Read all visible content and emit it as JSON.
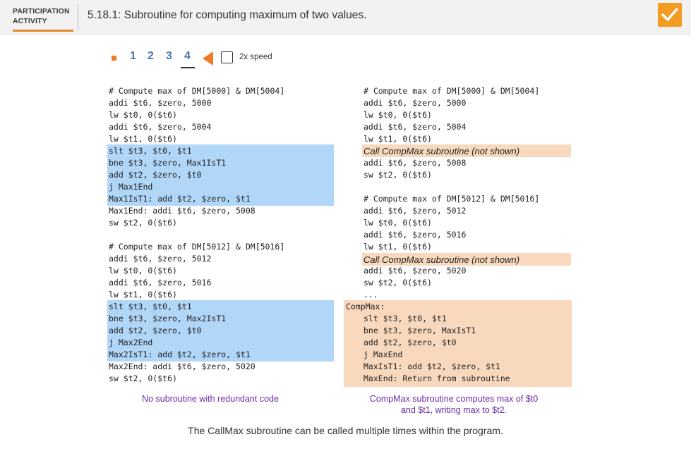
{
  "header": {
    "label_line1": "PARTICIPATION",
    "label_line2": "ACTIVITY",
    "title": "5.18.1: Subroutine for computing maximum of two values."
  },
  "controls": {
    "steps": [
      "1",
      "2",
      "3",
      "4"
    ],
    "current_step": "4",
    "speed_label": "2x speed"
  },
  "left_code": {
    "block1": [
      "# Compute max of DM[5000] & DM[5004]",
      "addi $t6, $zero, 5000",
      "lw $t0, 0($t6)",
      "addi $t6, $zero, 5004",
      "lw $t1, 0($t6)",
      "slt $t3, $t0, $t1",
      "bne $t3, $zero, Max1IsT1",
      "add $t2, $zero, $t0",
      "j Max1End",
      "Max1IsT1: add $t2, $zero, $t1",
      "Max1End: addi $t6, $zero, 5008",
      "sw $t2, 0($t6)"
    ],
    "block2": [
      "# Compute max of DM[5012] & DM[5016]",
      "addi $t6, $zero, 5012",
      "lw $t0, 0($t6)",
      "addi $t6, $zero, 5016",
      "lw $t1, 0($t6)",
      "slt $t3, $t0, $t1",
      "bne $t3, $zero, Max2IsT1",
      "add $t2, $zero, $t0",
      "j Max2End",
      "Max2IsT1: add $t2, $zero, $t1",
      "Max2End: addi $t6, $zero, 5020",
      "sw $t2, 0($t6)"
    ]
  },
  "right_code": {
    "block1": [
      "# Compute max of DM[5000] & DM[5004]",
      "addi $t6, $zero, 5000",
      "lw $t0, 0($t6)",
      "addi $t6, $zero, 5004",
      "lw $t1, 0($t6)",
      "Call CompMax subroutine (not shown)",
      "addi $t6, $zero, 5008",
      "sw $t2, 0($t6)"
    ],
    "block2": [
      "# Compute max of DM[5012] & DM[5016]",
      "addi $t6, $zero, 5012",
      "lw $t0, 0($t6)",
      "addi $t6, $zero, 5016",
      "lw $t1, 0($t6)",
      "Call CompMax subroutine (not shown)",
      "addi $t6, $zero, 5020",
      "sw $t2, 0($t6)",
      "..."
    ],
    "subroutine": [
      "CompMax:",
      "slt $t3, $t0, $t1",
      "bne $t3, $zero, MaxIsT1",
      "add $t2, $zero, $t0",
      "j MaxEnd",
      "MaxIsT1: add $t2, $zero, $t1",
      "MaxEnd: Return from subroutine"
    ]
  },
  "captions": {
    "left": "No subroutine with redundant code",
    "right_line1": "CompMax subroutine computes max of $t0",
    "right_line2": "and $t1, writing max to $t2."
  },
  "footer": "The CallMax subroutine can be called multiple times within the program.",
  "colors": {
    "accent_orange": "#f07c2a",
    "highlight_blue": "#b0d6f8",
    "highlight_peach": "#f9d9bd",
    "caption_purple": "#6b2aa8",
    "step_blue": "#4a76a8"
  }
}
